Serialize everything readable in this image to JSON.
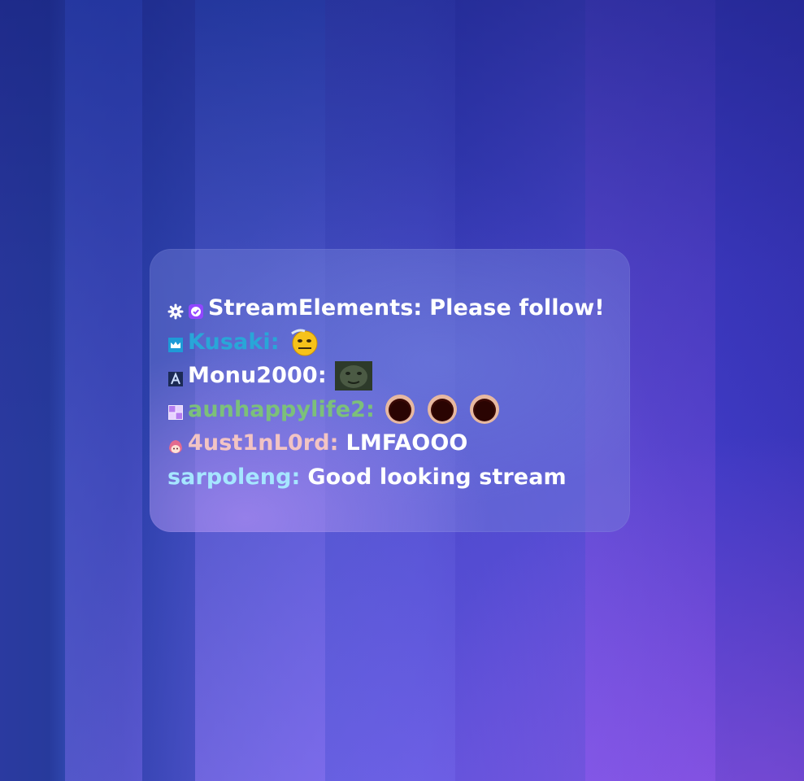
{
  "colors": {
    "panel": "#7a82dc",
    "text": "#ffffff",
    "streamelements": "#ffffff",
    "kusaki": "#29a6d8",
    "monu2000": "#ffffff",
    "aunhappylife2": "#7cc07a",
    "4ust1nL0rd": "#f2c4c4",
    "sarpoleng": "#a6e6ff"
  },
  "chat": {
    "messages": [
      {
        "badges": [
          "gear-badge-icon",
          "verified-badge-icon"
        ],
        "username": "StreamElements",
        "separator": ":",
        "text": "Please follow!",
        "emotes": []
      },
      {
        "badges": [
          "crown-badge-icon"
        ],
        "username": "Kusaki",
        "separator": ":",
        "text": "",
        "emotes": [
          "sweating-face-emote"
        ]
      },
      {
        "badges": [
          "letter-a-badge-icon"
        ],
        "username": "Monu2000",
        "separator": ":",
        "text": "",
        "emotes": [
          "dark-face-emote"
        ]
      },
      {
        "badges": [
          "2023-badge-icon"
        ],
        "username": "aunhappylife2",
        "separator": ":",
        "text": "",
        "emotes": [
          "shocked-mouth-emote",
          "shocked-mouth-emote",
          "shocked-mouth-emote"
        ]
      },
      {
        "badges": [
          "anime-girl-badge-icon"
        ],
        "username": "4ust1nL0rd",
        "separator": ":",
        "text": "LMFAOOO",
        "emotes": []
      },
      {
        "badges": [],
        "username": "sarpoleng",
        "separator": ":",
        "text": "Good looking stream",
        "emotes": []
      }
    ]
  }
}
